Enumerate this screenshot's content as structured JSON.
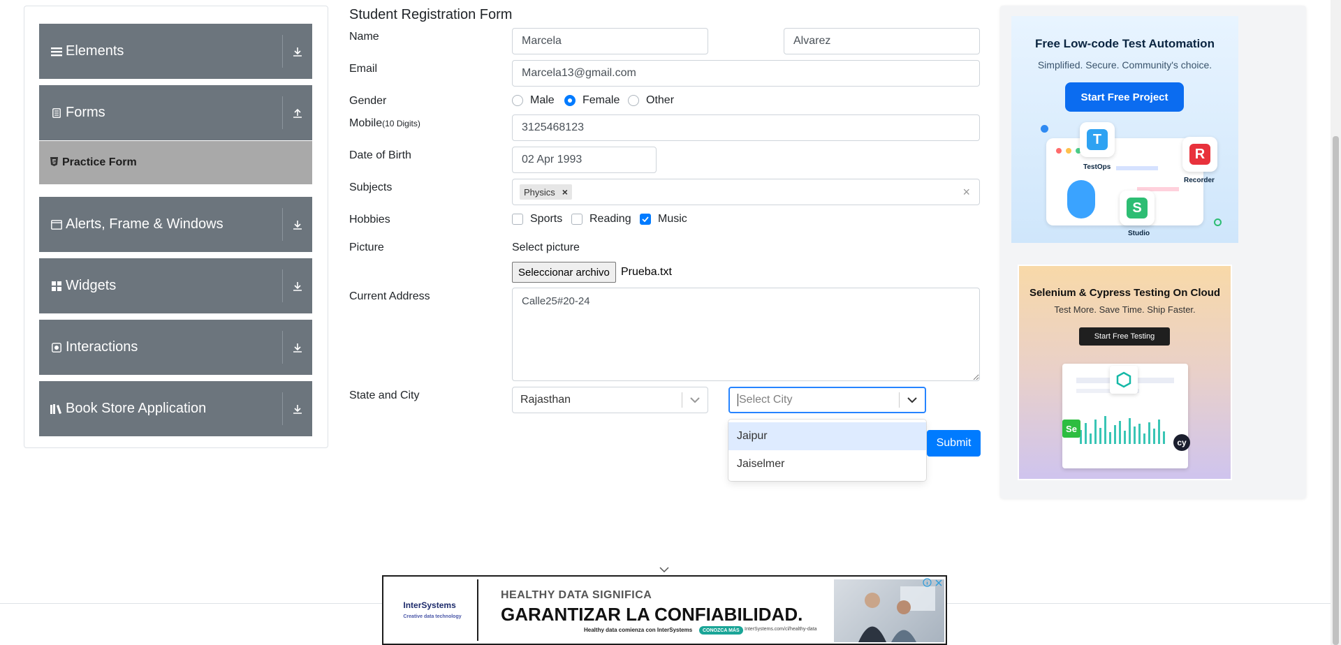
{
  "sidebar": {
    "groups": [
      {
        "label": "Elements",
        "icon": "hamburger-icon",
        "arrow": "download-icon"
      },
      {
        "label": "Forms",
        "icon": "document-icon",
        "arrow": "upload-icon"
      },
      {
        "label": "Alerts, Frame & Windows",
        "icon": "window-icon",
        "arrow": "download-icon"
      },
      {
        "label": "Widgets",
        "icon": "widgets-grid-icon",
        "arrow": "download-icon"
      },
      {
        "label": "Interactions",
        "icon": "interactions-icon",
        "arrow": "download-icon"
      },
      {
        "label": "Book Store Application",
        "icon": "books-icon",
        "arrow": "download-icon"
      }
    ],
    "active_sub": {
      "label": "Practice Form",
      "icon": "html5-icon"
    }
  },
  "form": {
    "title": "Student Registration Form",
    "name_label": "Name",
    "first_name": "Marcela",
    "last_name": "Alvarez",
    "email_label": "Email",
    "email": "Marcela13@gmail.com",
    "gender_label": "Gender",
    "genders": [
      "Male",
      "Female",
      "Other"
    ],
    "gender_selected": "Female",
    "mobile_label": "Mobile",
    "mobile_hint": "(10 Digits)",
    "mobile": "3125468123",
    "dob_label": "Date of Birth",
    "dob": "02 Apr 1993",
    "subjects_label": "Subjects",
    "subjects": [
      "Physics"
    ],
    "hobbies_label": "Hobbies",
    "hobbies": [
      {
        "label": "Sports",
        "checked": false
      },
      {
        "label": "Reading",
        "checked": false
      },
      {
        "label": "Music",
        "checked": true
      }
    ],
    "picture_label": "Picture",
    "select_picture": "Select picture",
    "file_button": "Seleccionar archivo",
    "file_name": "Prueba.txt",
    "address_label": "Current Address",
    "address": "Calle25#20-24",
    "state_city_label": "State and City",
    "state": "Rajasthan",
    "city_placeholder": "Select City",
    "city_options": [
      "Jaipur",
      "Jaiselmer"
    ],
    "city_highlighted": "Jaipur",
    "submit": "Submit"
  },
  "ads": {
    "ad1": {
      "headline": "Free Low-code Test Automation",
      "subline": "Simplified. Secure. Community's choice.",
      "button": "Start Free Project",
      "tiles": [
        "TestOps",
        "Recorder",
        "Studio"
      ]
    },
    "ad2": {
      "headline": "Selenium & Cypress Testing On Cloud",
      "subline": "Test More. Save Time. Ship Faster.",
      "button": "Start Free Testing"
    },
    "bottom": {
      "brand": "InterSystems",
      "brand_tag": "Creative data technology",
      "line1": "HEALTHY DATA SIGNIFICA",
      "line2": "GARANTIZAR LA CONFIABILIDAD.",
      "line3": "Healthy data comienza con InterSystems",
      "pill": "CONOZCA MÁS",
      "url": "InterSystems.com/cl/healthy-data"
    }
  },
  "colors": {
    "sidebar_group": "#6c757d",
    "sidebar_active": "#a9a9a9",
    "primary": "#007bff",
    "focus": "#2684ff",
    "option_highlight": "#deebff"
  }
}
